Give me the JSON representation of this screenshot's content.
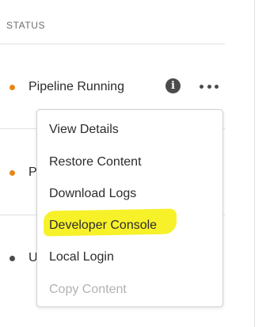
{
  "table": {
    "status_header": "STATUS",
    "rows": [
      {
        "status": "Pipeline Running",
        "dot_color": "#e68619"
      },
      {
        "status": "P",
        "dot_color": "#e68619"
      },
      {
        "status": "U",
        "dot_color": "#4b4b4b"
      }
    ],
    "info_icon": "info-icon",
    "more_icon": "more-horizontal-icon",
    "info_glyph": "i"
  },
  "menu": {
    "items": [
      {
        "label": "View Details",
        "enabled": true
      },
      {
        "label": "Restore Content",
        "enabled": true
      },
      {
        "label": "Download Logs",
        "enabled": true
      },
      {
        "label": "Developer Console",
        "enabled": true,
        "highlighted": true
      },
      {
        "label": "Local Login",
        "enabled": true
      },
      {
        "label": "Copy Content",
        "enabled": false
      }
    ]
  },
  "colors": {
    "warning_dot": "#e68619",
    "neutral_dot": "#4b4b4b",
    "highlight": "#f7f12a",
    "disabled_text": "#b3b3b3"
  }
}
